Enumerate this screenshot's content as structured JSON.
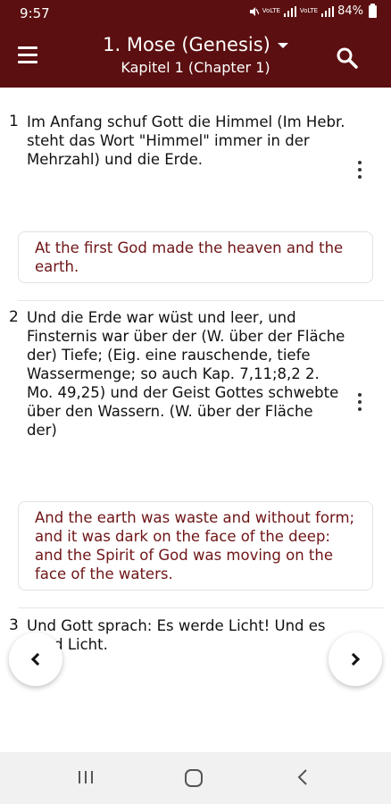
{
  "status_bar": {
    "time": "9:57",
    "network_1": "VoLTE",
    "network_2": "VoLTE",
    "battery": "84%"
  },
  "app_bar": {
    "book_title": "1. Mose (Genesis)",
    "chapter_title": "Kapitel 1 (Chapter 1)",
    "menu_icon": "hamburger-menu-icon",
    "search_icon": "search-icon",
    "dropdown_icon": "dropdown-caret-icon"
  },
  "verses": [
    {
      "number": "1",
      "text": "Im Anfang schuf Gott die Himmel (Im Hebr. steht das Wort \"Himmel\" immer in der Mehrzahl)   und die Erde.",
      "translation": "At the first God made the heaven and the earth."
    },
    {
      "number": "2",
      "text": "Und die Erde war wüst und leer, und Finsternis war über der  (W. über der Fläche der)   Tiefe;  (Eig. eine rauschende, tiefe Wassermenge; so auch Kap. 7,11;8,2 2. Mo. 49,25)   und der Geist Gottes schwebte über den Wassern.  (W. über der Fläche der)",
      "translation": "And the earth was waste and without form; and it was dark on the face of the deep: and the Spirit of God was moving on the face of the waters."
    },
    {
      "number": "3",
      "text": "Und Gott sprach: Es werde Licht! Und es ward Licht.",
      "translation": ""
    }
  ],
  "navigation": {
    "previous_icon": "chevron-left-icon",
    "next_icon": "chevron-right-icon"
  },
  "system_nav": {
    "recents_icon": "recents-icon",
    "home_icon": "home-icon",
    "back_icon": "back-icon"
  },
  "colors": {
    "primary": "#5b0f10",
    "translation_text": "#6f1517"
  }
}
